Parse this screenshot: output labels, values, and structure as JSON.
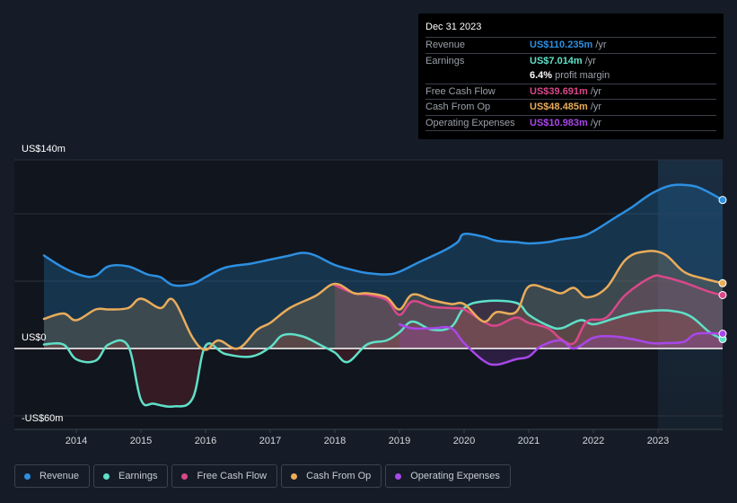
{
  "tooltip": {
    "date": "Dec 31 2023",
    "rows": [
      {
        "label": "Revenue",
        "value": "US$110.235m",
        "unit": "/yr",
        "color": "#2d8fe0"
      },
      {
        "label": "Earnings",
        "value": "US$7.014m",
        "unit": "/yr",
        "color": "#5fe0c8"
      },
      {
        "label": "",
        "value": "6.4%",
        "unit": "profit margin",
        "color": "#ffffff"
      },
      {
        "label": "Free Cash Flow",
        "value": "US$39.691m",
        "unit": "/yr",
        "color": "#d9488a"
      },
      {
        "label": "Cash From Op",
        "value": "US$48.485m",
        "unit": "/yr",
        "color": "#e9ac5a"
      },
      {
        "label": "Operating Expenses",
        "value": "US$10.983m",
        "unit": "/yr",
        "color": "#a847e8"
      }
    ]
  },
  "legend": [
    {
      "label": "Revenue",
      "color": "#2d8fe0"
    },
    {
      "label": "Earnings",
      "color": "#5fe0c8"
    },
    {
      "label": "Free Cash Flow",
      "color": "#d9488a"
    },
    {
      "label": "Cash From Op",
      "color": "#e9ac5a"
    },
    {
      "label": "Operating Expenses",
      "color": "#a847e8"
    }
  ],
  "chart_data": {
    "type": "line",
    "title": "",
    "xlabel": "",
    "ylabel": "",
    "y_tick_labels": [
      "US$140m",
      "US$0",
      "-US$60m"
    ],
    "x_tick_labels": [
      "2014",
      "2015",
      "2016",
      "2017",
      "2018",
      "2019",
      "2020",
      "2021",
      "2022",
      "2023"
    ],
    "xlim": [
      2013.5,
      2024.0
    ],
    "ylim": [
      -60,
      140
    ],
    "grid": true,
    "highlight_range": [
      2023.0,
      2024.0
    ],
    "legend_position": "bottom",
    "series": [
      {
        "name": "Revenue",
        "color": "#2d8fe0",
        "x": [
          2013.5,
          2013.8,
          2014.1,
          2014.3,
          2014.5,
          2014.8,
          2015.1,
          2015.3,
          2015.5,
          2015.8,
          2016.0,
          2016.3,
          2016.7,
          2017.0,
          2017.3,
          2017.5,
          2017.7,
          2018.0,
          2018.3,
          2018.5,
          2018.8,
          2019.0,
          2019.3,
          2019.7,
          2019.9,
          2020.0,
          2020.3,
          2020.5,
          2020.8,
          2021.0,
          2021.3,
          2021.5,
          2021.8,
          2022.0,
          2022.3,
          2022.6,
          2022.9,
          2023.2,
          2023.5,
          2023.7,
          2024.0
        ],
        "values": [
          69,
          60,
          54,
          54,
          61,
          61,
          55,
          53,
          47,
          48,
          53,
          60,
          63,
          66,
          69,
          71,
          69,
          62,
          58,
          56,
          55,
          57,
          64,
          73,
          79,
          85,
          83,
          80,
          79,
          78,
          79,
          81,
          83,
          87,
          96,
          105,
          115,
          121,
          121,
          118,
          110.235
        ]
      },
      {
        "name": "Earnings",
        "color": "#5fe0c8",
        "x": [
          2013.5,
          2013.8,
          2014.0,
          2014.3,
          2014.5,
          2014.8,
          2015.0,
          2015.2,
          2015.5,
          2015.8,
          2016.0,
          2016.3,
          2016.7,
          2017.0,
          2017.2,
          2017.5,
          2017.8,
          2018.0,
          2018.2,
          2018.5,
          2018.8,
          2019.0,
          2019.2,
          2019.5,
          2019.8,
          2020.0,
          2020.3,
          2020.8,
          2021.0,
          2021.3,
          2021.5,
          2021.8,
          2022.0,
          2022.3,
          2022.6,
          2022.9,
          2023.2,
          2023.5,
          2023.8,
          2024.0
        ],
        "values": [
          3,
          3,
          -8,
          -9,
          3,
          2,
          -38,
          -41,
          -43,
          -37,
          2,
          -4,
          -6,
          1,
          10,
          9,
          2,
          -3,
          -10,
          3,
          6,
          12,
          20,
          14,
          16,
          30,
          35,
          34,
          25,
          17,
          15,
          21,
          18,
          22,
          26,
          28,
          28,
          24,
          12,
          7.014
        ]
      },
      {
        "name": "Free Cash Flow",
        "color": "#d9488a",
        "x": [
          2018.0,
          2018.3,
          2018.5,
          2018.8,
          2019.0,
          2019.2,
          2019.5,
          2019.8,
          2020.0,
          2020.3,
          2020.5,
          2020.8,
          2021.0,
          2021.3,
          2021.5,
          2021.7,
          2021.9,
          2022.2,
          2022.5,
          2022.9,
          2023.1,
          2023.4,
          2023.8,
          2024.0
        ],
        "values": [
          47,
          41,
          40,
          36,
          25,
          35,
          31,
          30,
          29,
          20,
          17,
          23,
          19,
          15,
          7,
          4,
          20,
          23,
          40,
          53,
          53,
          49,
          42,
          39.691
        ]
      },
      {
        "name": "Cash From Op",
        "color": "#e9ac5a",
        "x": [
          2013.5,
          2013.8,
          2014.0,
          2014.3,
          2014.5,
          2014.8,
          2015.0,
          2015.3,
          2015.5,
          2015.8,
          2016.0,
          2016.2,
          2016.5,
          2016.8,
          2017.0,
          2017.3,
          2017.7,
          2018.0,
          2018.3,
          2018.5,
          2018.8,
          2019.0,
          2019.2,
          2019.5,
          2019.8,
          2020.0,
          2020.3,
          2020.5,
          2020.8,
          2021.0,
          2021.3,
          2021.5,
          2021.7,
          2021.9,
          2022.2,
          2022.5,
          2022.8,
          2023.1,
          2023.4,
          2023.7,
          2024.0
        ],
        "values": [
          22,
          26,
          21,
          29,
          29,
          30,
          37,
          30,
          36,
          8,
          -1,
          6,
          0,
          14,
          19,
          30,
          39,
          48,
          41,
          41,
          38,
          29,
          40,
          36,
          33,
          33,
          20,
          27,
          27,
          46,
          44,
          41,
          45,
          38,
          45,
          66,
          72,
          70,
          57,
          52,
          48.485
        ]
      },
      {
        "name": "Operating Expenses",
        "color": "#a847e8",
        "x": [
          2019.0,
          2019.2,
          2019.5,
          2019.8,
          2020.0,
          2020.3,
          2020.5,
          2020.8,
          2021.0,
          2021.2,
          2021.5,
          2021.7,
          2022.0,
          2022.3,
          2022.6,
          2022.9,
          2023.1,
          2023.4,
          2023.6,
          2024.0
        ],
        "values": [
          18,
          15,
          15,
          15,
          4,
          -9,
          -12,
          -8,
          -6,
          2,
          6,
          0,
          8,
          9,
          7,
          4,
          4,
          5,
          11,
          10.983
        ]
      }
    ]
  }
}
